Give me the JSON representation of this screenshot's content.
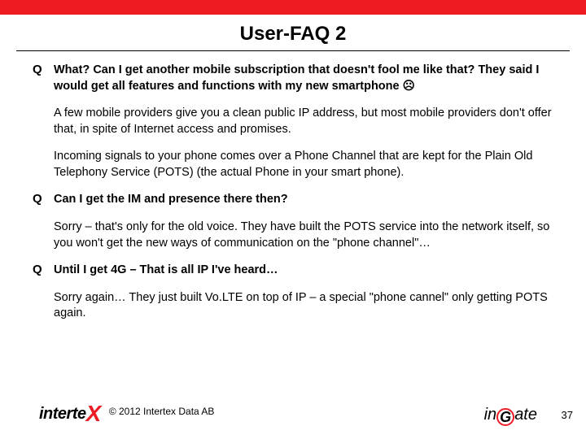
{
  "title": "User-FAQ 2",
  "items": [
    {
      "q": "Q",
      "bold": true,
      "text": "What? Can I get another mobile subscription that doesn't fool me like that? They said I would get all features and functions with my new smartphone ",
      "sad": "☹"
    },
    {
      "q": "",
      "bold": false,
      "text": "A few mobile providers give you a clean public IP address, but most mobile providers don't  offer that, in spite of Internet access and promises."
    },
    {
      "q": "",
      "bold": false,
      "text": "Incoming signals to your phone comes over a Phone Channel that are kept for the Plain Old Telephony Service (POTS) (the actual Phone in your smart phone)."
    },
    {
      "q": "Q",
      "bold": true,
      "text": "Can I get the IM and presence there then?"
    },
    {
      "q": "",
      "bold": false,
      "text": "Sorry – that's only for the old voice. They have built the POTS service into the network itself, so you won't get the new ways of communication on the \"phone channel\"…"
    },
    {
      "q": "Q",
      "bold": true,
      "text": "Until I get 4G – That is all IP I've heard…"
    },
    {
      "q": "",
      "bold": false,
      "text": "Sorry again… They just built Vo.LTE on top of IP –  a special \"phone cannel\" only getting POTS again."
    }
  ],
  "footer": {
    "left_logo_a": "interte",
    "left_logo_b": "X",
    "copyright": "© 2012 Intertex Data AB",
    "right_logo_a": "in",
    "right_logo_g": "G",
    "right_logo_b": "ate"
  },
  "pagenum": "37"
}
